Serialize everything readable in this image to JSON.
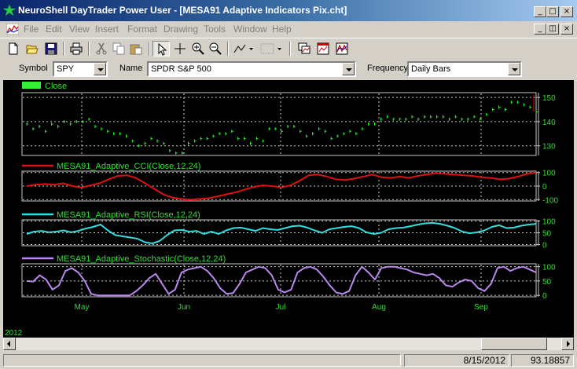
{
  "window": {
    "title": "NeuroShell DayTrader Power User - [MESA91 Adaptive Indicators Pix.cht]",
    "min_glyph": "_",
    "max_glyph": "□",
    "close_glyph": "×",
    "restore_glyph": "◫"
  },
  "menu": [
    "File",
    "Edit",
    "View",
    "Insert",
    "Format",
    "Drawing",
    "Tools",
    "Window",
    "Help"
  ],
  "toolbar": {
    "icons": [
      "new-icon",
      "open-icon",
      "save-icon",
      "print-icon",
      "cut-icon",
      "copy-icon",
      "paste-icon",
      "pointer-icon",
      "crosshair-icon",
      "zoom-in-icon",
      "zoom-out-icon",
      "line-tool-icon",
      "pattern-tool-icon",
      "chart-window-icon",
      "chart-type-icon",
      "indicator-icon"
    ]
  },
  "symbol_bar": {
    "symbol_label": "Symbol",
    "symbol_value": "SPY",
    "name_label": "Name",
    "name_value": "SPDR S&P 500",
    "frequency_label": "Frequency",
    "frequency_value": "Daily Bars"
  },
  "colors": {
    "price": "#33ee33",
    "cci": "#dd1111",
    "rsi": "#33dddd",
    "stoch": "#bb88ee",
    "text": "#33dd33",
    "grid": "#cccccc"
  },
  "chart_data": [
    {
      "type": "line",
      "title": "Close",
      "ylim": [
        126,
        152
      ],
      "yticks": [
        130,
        140,
        150
      ],
      "values": [
        139,
        137,
        138,
        136,
        139,
        138,
        140,
        139,
        140,
        140,
        141,
        138,
        137,
        136,
        135,
        135,
        134,
        132,
        130,
        131,
        133,
        132,
        131,
        128,
        127,
        127,
        131,
        132,
        133,
        133,
        134,
        135,
        135,
        136,
        133,
        133,
        131,
        133,
        132,
        137,
        137,
        136,
        138,
        138,
        136,
        134,
        135,
        137,
        136,
        133,
        134,
        135,
        136,
        135,
        137,
        139,
        139,
        141,
        142,
        141,
        141,
        141,
        142,
        141,
        142,
        142,
        142,
        142,
        141,
        142,
        141,
        141,
        142,
        141,
        143,
        145,
        146,
        145,
        148,
        148,
        147,
        146,
        144
      ]
    },
    {
      "type": "line",
      "title": "MESA91_Adaptive_CCI(Close,12,24)",
      "ylim": [
        -110,
        110
      ],
      "yticks": [
        100,
        0,
        -100
      ],
      "values": [
        0,
        10,
        15,
        10,
        20,
        0,
        -10,
        5,
        20,
        50,
        75,
        80,
        60,
        20,
        -20,
        -60,
        -85,
        -95,
        -100,
        -95,
        -90,
        -75,
        -60,
        -45,
        -25,
        -5,
        5,
        0,
        -10,
        5,
        40,
        80,
        85,
        70,
        50,
        45,
        55,
        70,
        85,
        65,
        60,
        70,
        60,
        75,
        85,
        95,
        90,
        85,
        80,
        75,
        65,
        60,
        50,
        55,
        70,
        90,
        100
      ]
    },
    {
      "type": "line",
      "title": "MESA91_Adaptive_RSI(Close,12,24)",
      "ylim": [
        -5,
        105
      ],
      "yticks": [
        100,
        50,
        0
      ],
      "values": [
        45,
        55,
        58,
        52,
        55,
        60,
        52,
        58,
        68,
        75,
        85,
        60,
        40,
        35,
        30,
        25,
        10,
        5,
        15,
        40,
        60,
        62,
        55,
        58,
        45,
        55,
        45,
        60,
        70,
        72,
        65,
        58,
        70,
        65,
        62,
        70,
        78,
        80,
        72,
        60,
        50,
        65,
        70,
        75,
        78,
        70,
        52,
        45,
        50,
        65,
        70,
        72,
        78,
        85,
        90,
        92,
        88,
        80,
        70,
        55,
        48,
        52,
        60,
        75,
        82,
        70,
        72,
        80,
        85,
        88
      ]
    },
    {
      "type": "line",
      "title": "MESA91_Adaptive_Stochastic(Close,12,24)",
      "ylim": [
        -5,
        110
      ],
      "yticks": [
        100,
        50,
        0
      ],
      "values": [
        50,
        48,
        70,
        55,
        20,
        35,
        85,
        95,
        80,
        50,
        5,
        0,
        0,
        0,
        0,
        0,
        0,
        15,
        35,
        60,
        75,
        40,
        5,
        20,
        80,
        90,
        95,
        100,
        85,
        60,
        25,
        5,
        8,
        40,
        80,
        90,
        100,
        95,
        70,
        20,
        10,
        20,
        80,
        95,
        100,
        90,
        65,
        35,
        10,
        5,
        15,
        70,
        100,
        80,
        55,
        95,
        100,
        100,
        95,
        90,
        80,
        75,
        70,
        75,
        60,
        35,
        30,
        45,
        55,
        50,
        25,
        15,
        40,
        95,
        100,
        85,
        95,
        100,
        90,
        80
      ]
    }
  ],
  "x_axis": {
    "labels": [
      "May",
      "Jun",
      "Jul",
      "Aug",
      "Sep"
    ],
    "year_label": "2012"
  },
  "status": {
    "message": "",
    "date": "8/15/2012",
    "value": "93.18857"
  }
}
